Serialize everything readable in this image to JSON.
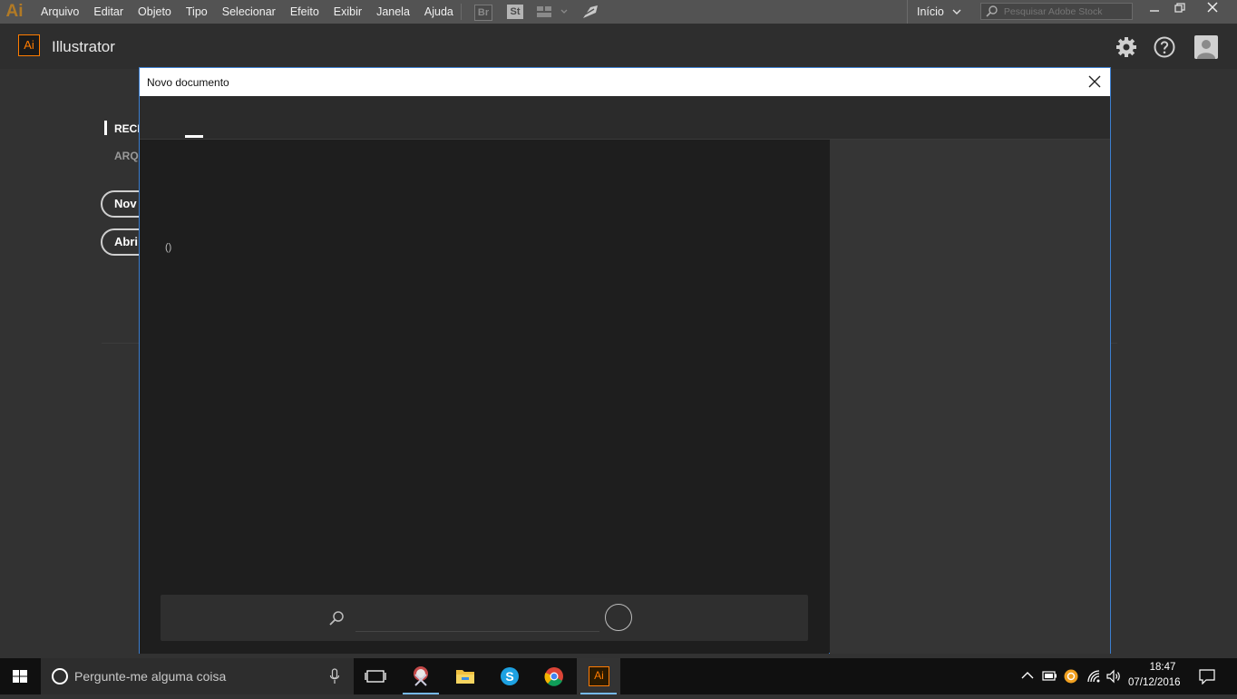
{
  "menubar": {
    "logo": "Ai",
    "items": [
      "Arquivo",
      "Editar",
      "Objeto",
      "Tipo",
      "Selecionar",
      "Efeito",
      "Exibir",
      "Janela",
      "Ajuda"
    ],
    "bridge_label": "Br",
    "stock_label": "St",
    "workspace": "Início",
    "stock_search_placeholder": "Pesquisar Adobe Stock"
  },
  "header": {
    "app_badge": "Ai",
    "app_name": "Illustrator"
  },
  "start_screen": {
    "nav_recent": "RECE",
    "nav_files": "ARQ",
    "new_button": "Nov",
    "open_button": "Abri"
  },
  "dialog": {
    "title": "Novo documento",
    "presets_count": "()",
    "template_search_placeholder": ""
  },
  "taskbar": {
    "cortana_placeholder": "Pergunte-me alguma coisa",
    "illustrator_label": "Ai",
    "time": "18:47",
    "date": "07/12/2016"
  },
  "colors": {
    "accent_orange": "#ff7c00",
    "dialog_border": "#3c7fd0",
    "taskbar_active": "#76b9ed"
  }
}
